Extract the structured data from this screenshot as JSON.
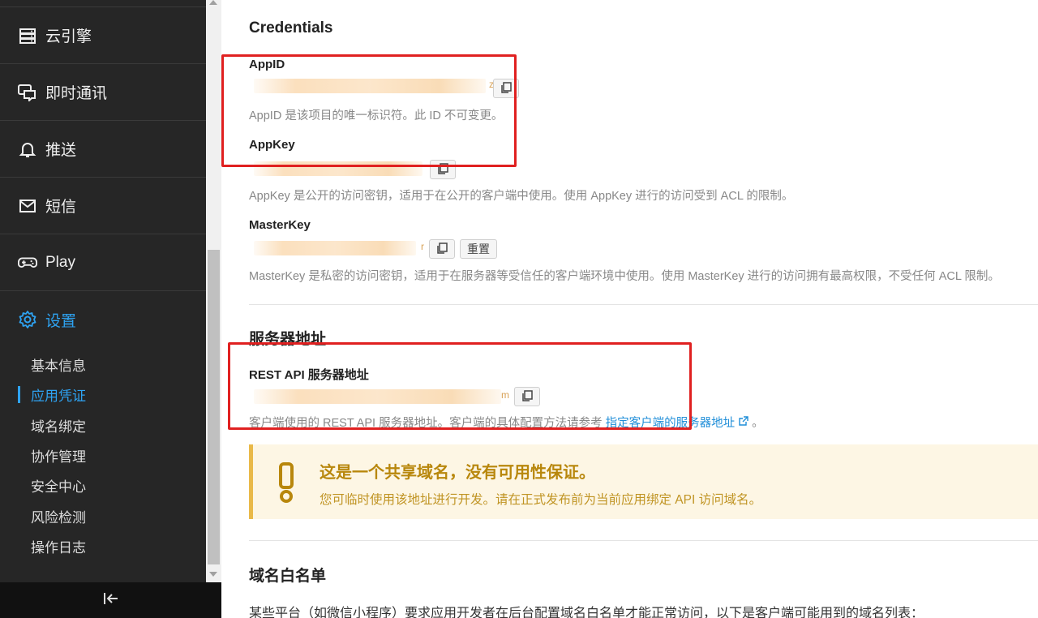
{
  "sidebar": {
    "items": [
      {
        "label": "云引擎",
        "icon": "server-icon"
      },
      {
        "label": "即时通讯",
        "icon": "chat-icon"
      },
      {
        "label": "推送",
        "icon": "bell-icon"
      },
      {
        "label": "短信",
        "icon": "mail-icon"
      },
      {
        "label": "Play",
        "icon": "gamepad-icon"
      },
      {
        "label": "设置",
        "icon": "gear-icon"
      }
    ],
    "sub_items": [
      "基本信息",
      "应用凭证",
      "域名绑定",
      "协作管理",
      "安全中心",
      "风险检测",
      "操作日志"
    ],
    "collapse_icon": "collapse-left-icon"
  },
  "credentials": {
    "title": "Credentials",
    "appid": {
      "label": "AppID",
      "tail": "z",
      "hint": "AppID 是该项目的唯一标识符。此 ID 不可变更。"
    },
    "appkey": {
      "label": "AppKey",
      "hint": "AppKey 是公开的访问密钥，适用于在公开的客户端中使用。使用 AppKey 进行的访问受到 ACL 的限制。"
    },
    "masterkey": {
      "label": "MasterKey",
      "tail": "r",
      "reset_label": "重置",
      "hint": "MasterKey 是私密的访问密钥，适用于在服务器等受信任的客户端环境中使用。使用 MasterKey 进行的访问拥有最高权限，不受任何 ACL 限制。"
    }
  },
  "server": {
    "title": "服务器地址",
    "rest_label": "REST API 服务器地址",
    "tail": "m",
    "hint_prefix": "客户端使用的 REST API 服务器地址。客户端的具体配置方法请参考 ",
    "hint_link": "指定客户端的服务器地址",
    "hint_suffix": " 。"
  },
  "warning": {
    "title": "这是一个共享域名，没有可用性保证。",
    "desc": "您可临时使用该地址进行开发。请在正式发布前为当前应用绑定 API 访问域名。"
  },
  "whitelist": {
    "title": "域名白名单",
    "desc": "某些平台（如微信小程序）要求应用开发者在后台配置域名白名单才能正常访问，以下是客户端可能用到的域名列表："
  },
  "colors": {
    "accent": "#2ea3f2",
    "sidebar_bg": "#262626",
    "warn_bg": "#fdf6e4",
    "warn_text": "#b8870c",
    "highlight": "#e02020"
  }
}
